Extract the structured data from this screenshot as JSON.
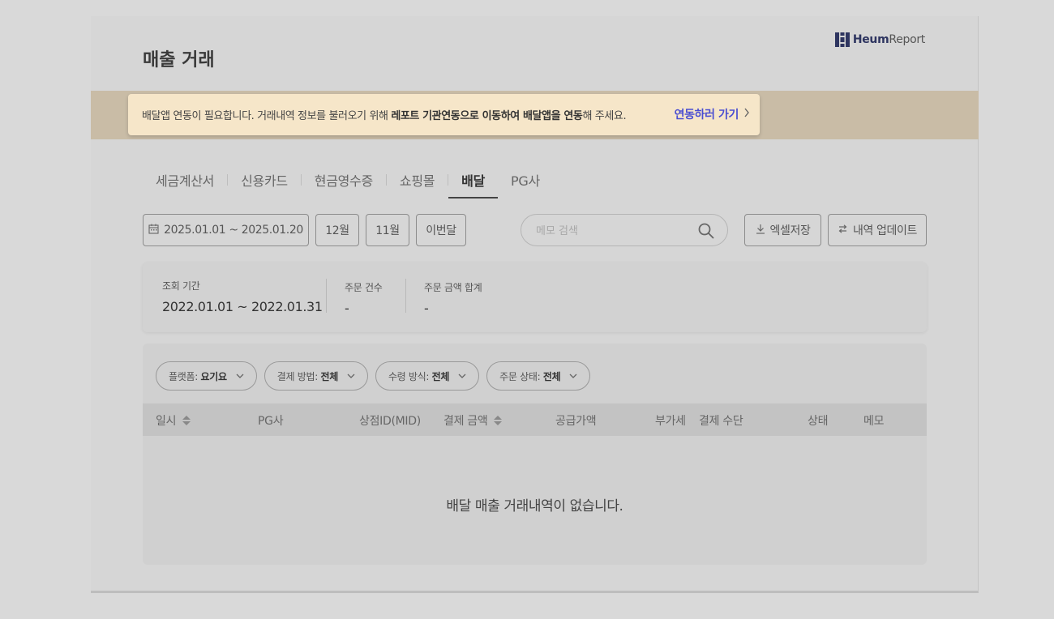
{
  "header": {
    "title": "매출 거래",
    "logo_bold": "Heum",
    "logo_light": "Report"
  },
  "banner": {
    "msg_prefix": "배달앱 연동이 필요합니다. 거래내역 정보를 불러오기 위해 ",
    "msg_bold": "레포트 기관연동으로 이동하여 배달앱을 연동",
    "msg_suffix": "해 주세요.",
    "link_label": "연동하러 가기",
    "link_icon": "chevron-right-icon",
    "link_color": "#4b4fd1"
  },
  "tabs": [
    {
      "label": "세금계산서",
      "active": false
    },
    {
      "label": "신용카드",
      "active": false
    },
    {
      "label": "현금영수증",
      "active": false
    },
    {
      "label": "쇼핑몰",
      "active": false
    },
    {
      "label": "배달",
      "active": true
    },
    {
      "label": "PG사",
      "active": false
    }
  ],
  "toolbar": {
    "date_range": "2025.01.01 ~ 2025.01.20",
    "date_icon": "calendar-icon",
    "quick_1": "12월",
    "quick_2": "11월",
    "quick_3": "이번달",
    "search_placeholder": "메모 검색",
    "search_value": "",
    "excel_label": "엑셀저장",
    "update_label": "내역 업데이트"
  },
  "summary": {
    "period_label": "조회 기간",
    "period_value": "2022.01.01 ~ 2022.01.31",
    "count_label": "주문 건수",
    "count_value": "-",
    "amount_label": "주문 금액 합계",
    "amount_value": "-"
  },
  "filters": [
    {
      "label": "플랫폼: ",
      "value": "요기요"
    },
    {
      "label": "결제 방법: ",
      "value": "전체"
    },
    {
      "label": "수령 방식: ",
      "value": "전체"
    },
    {
      "label": "주문 상태: ",
      "value": "전체"
    }
  ],
  "table": {
    "columns": [
      "일시",
      "PG사",
      "상점ID(MID)",
      "결제 금액",
      "공급가액",
      "부가세",
      "결제 수단",
      "상태",
      "메모"
    ],
    "rows": [],
    "empty_message": "배달 매출 거래내역이 없습니다."
  }
}
